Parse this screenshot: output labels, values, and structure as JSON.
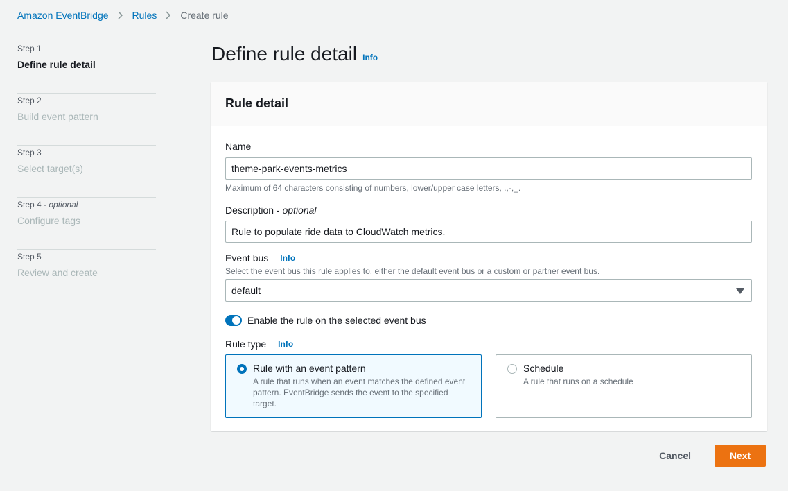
{
  "breadcrumb": {
    "items": [
      "Amazon EventBridge",
      "Rules",
      "Create rule"
    ]
  },
  "steps": [
    {
      "number": "Step 1",
      "optional": "",
      "title": "Define rule detail"
    },
    {
      "number": "Step 2",
      "optional": "",
      "title": "Build event pattern"
    },
    {
      "number": "Step 3",
      "optional": "",
      "title": "Select target(s)"
    },
    {
      "number": "Step 4",
      "optional": "optional",
      "title": "Configure tags"
    },
    {
      "number": "Step 5",
      "optional": "",
      "title": "Review and create"
    }
  ],
  "header": {
    "title": "Define rule detail",
    "info": "Info"
  },
  "rule_detail": {
    "heading": "Rule detail",
    "name": {
      "label": "Name",
      "value": "theme-park-events-metrics",
      "hint": "Maximum of 64 characters consisting of numbers, lower/upper case letters, .,-,_."
    },
    "description": {
      "label": "Description",
      "optional": "optional",
      "value": "Rule to populate ride data to CloudWatch metrics."
    },
    "event_bus": {
      "label": "Event bus",
      "info": "Info",
      "hint": "Select the event bus this rule applies to, either the default event bus or a custom or partner event bus.",
      "selected": "default"
    },
    "enable_toggle": {
      "label": "Enable the rule on the selected event bus",
      "enabled": true
    },
    "rule_type": {
      "label": "Rule type",
      "info": "Info",
      "options": [
        {
          "title": "Rule with an event pattern",
          "description": "A rule that runs when an event matches the defined event pattern. EventBridge sends the event to the specified target.",
          "selected": true
        },
        {
          "title": "Schedule",
          "description": "A rule that runs on a schedule",
          "selected": false
        }
      ]
    }
  },
  "footer": {
    "cancel_label": "Cancel",
    "next_label": "Next"
  },
  "colors": {
    "accent": "#0073bb",
    "primary_button": "#ec7211"
  }
}
